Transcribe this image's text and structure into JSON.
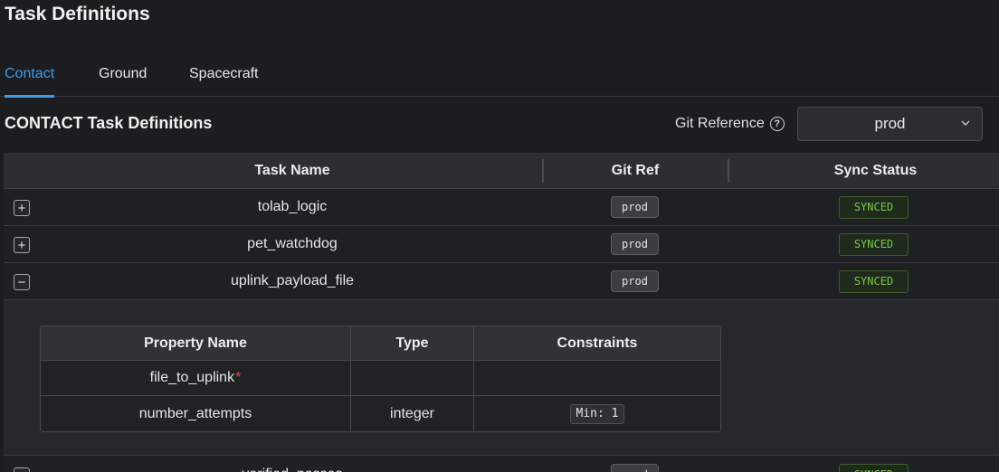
{
  "page": {
    "title": "Task Definitions"
  },
  "tabs": [
    {
      "label": "Contact",
      "active": true
    },
    {
      "label": "Ground",
      "active": false
    },
    {
      "label": "Spacecraft",
      "active": false
    }
  ],
  "section": {
    "title": "CONTACT Task Definitions",
    "git_ref_label": "Git Reference",
    "git_ref_value": "prod"
  },
  "table": {
    "headers": {
      "task_name": "Task Name",
      "git_ref": "Git Ref",
      "sync_status": "Sync Status"
    },
    "rows": [
      {
        "name": "tolab_logic",
        "git_ref": "prod",
        "status": "SYNCED",
        "expanded": false
      },
      {
        "name": "pet_watchdog",
        "git_ref": "prod",
        "status": "SYNCED",
        "expanded": false
      },
      {
        "name": "uplink_payload_file",
        "git_ref": "prod",
        "status": "SYNCED",
        "expanded": true
      },
      {
        "name": "verified_passes",
        "git_ref": "prod",
        "status": "SYNCED",
        "expanded": false
      }
    ]
  },
  "properties": {
    "headers": {
      "name": "Property Name",
      "type": "Type",
      "constraints": "Constraints"
    },
    "rows": [
      {
        "name": "file_to_uplink",
        "required_mark": "*",
        "type": "",
        "constraint": ""
      },
      {
        "name": "number_attempts",
        "required_mark": "",
        "type": "integer",
        "constraint": "Min: 1"
      }
    ]
  },
  "colors": {
    "accent": "#3d9bea",
    "synced": "#79c944",
    "required": "#e5484d",
    "background": "#1c1d1f"
  }
}
